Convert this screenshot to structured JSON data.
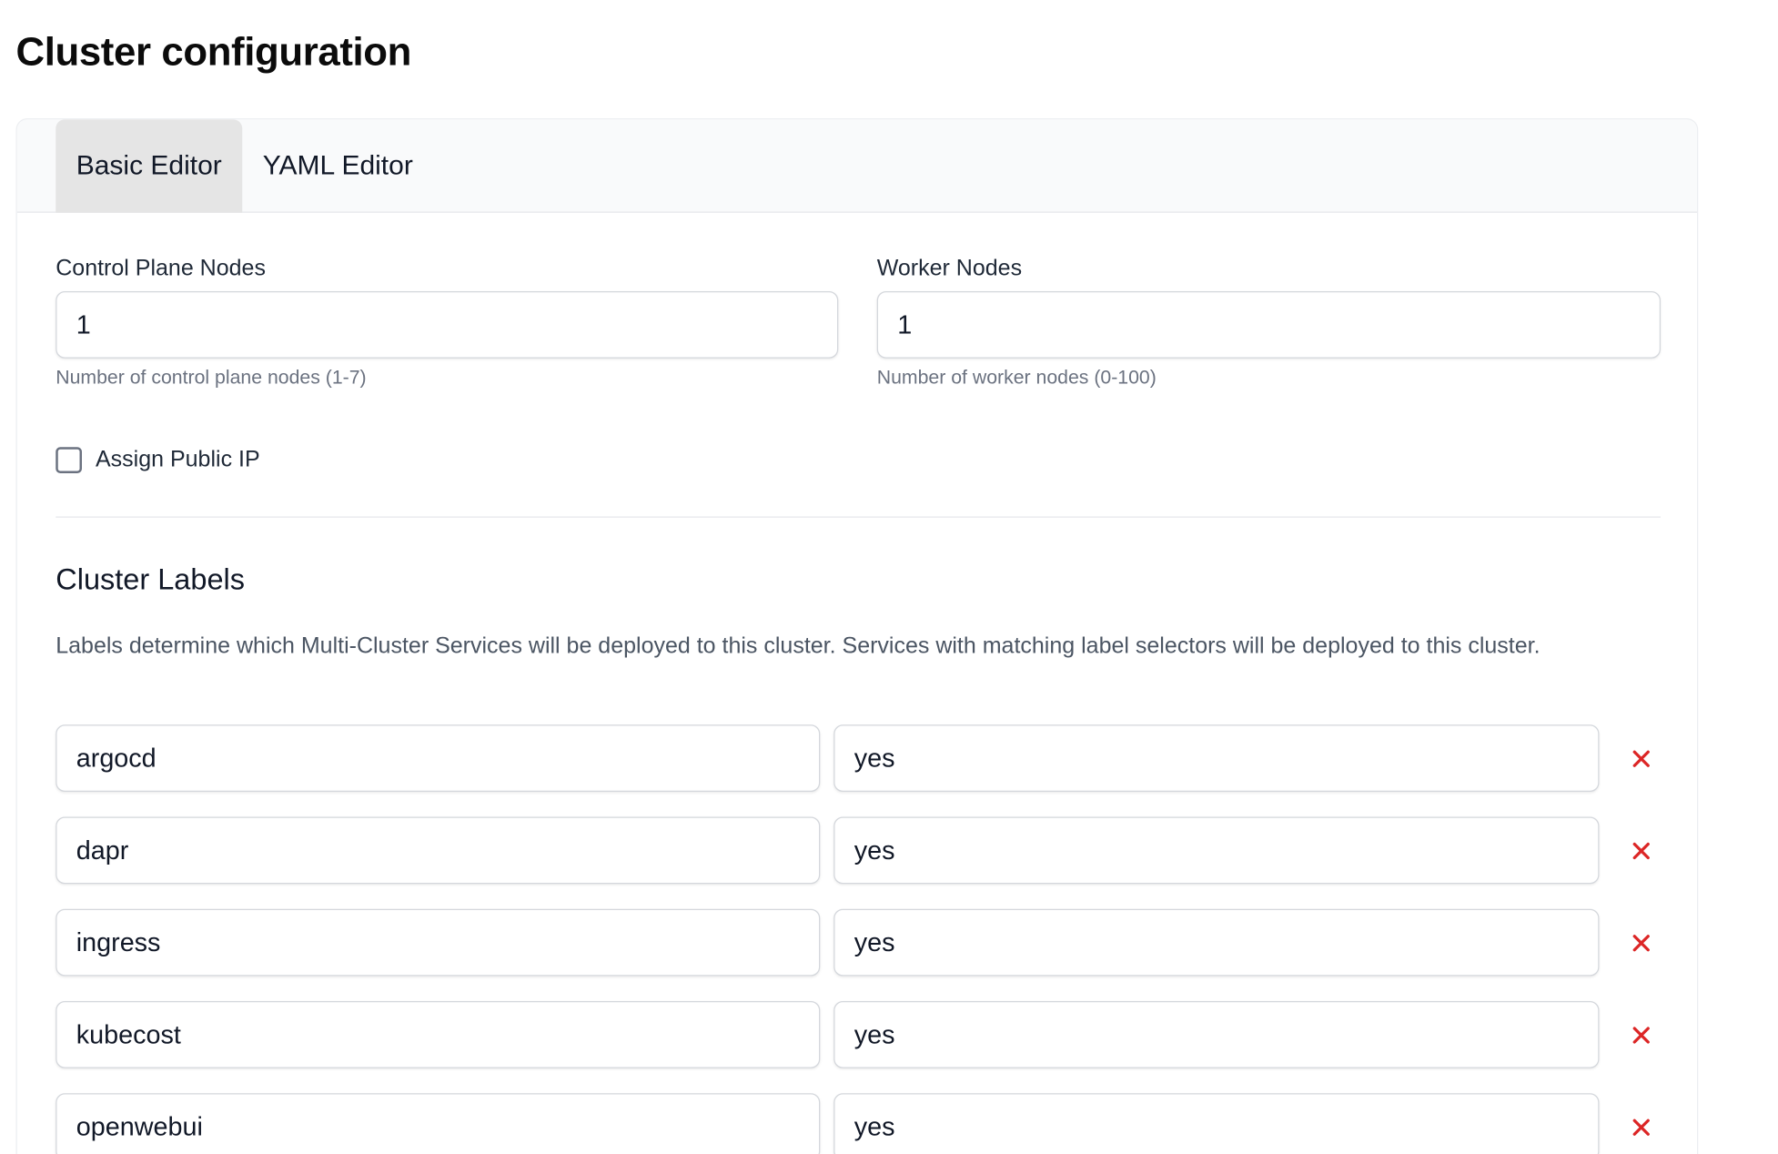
{
  "page": {
    "title": "Cluster configuration"
  },
  "tabs": [
    {
      "label": "Basic Editor",
      "active": true
    },
    {
      "label": "YAML Editor",
      "active": false
    }
  ],
  "nodes": {
    "control_plane": {
      "label": "Control Plane Nodes",
      "value": "1",
      "hint": "Number of control plane nodes (1-7)"
    },
    "worker": {
      "label": "Worker Nodes",
      "value": "1",
      "hint": "Number of worker nodes (0-100)"
    }
  },
  "public_ip": {
    "label": "Assign Public IP",
    "checked": false
  },
  "labels_section": {
    "title": "Cluster Labels",
    "description": "Labels determine which Multi-Cluster Services will be deployed to this cluster. Services with matching label selectors will be deployed to this cluster.",
    "rows": [
      {
        "key": "argocd",
        "value": "yes"
      },
      {
        "key": "dapr",
        "value": "yes"
      },
      {
        "key": "ingress",
        "value": "yes"
      },
      {
        "key": "kubecost",
        "value": "yes"
      },
      {
        "key": "openwebui",
        "value": "yes"
      }
    ]
  },
  "colors": {
    "remove_icon": "#dc2626",
    "active_tab_bg": "#e5e5e5"
  },
  "icons": {
    "remove": "close-icon"
  }
}
